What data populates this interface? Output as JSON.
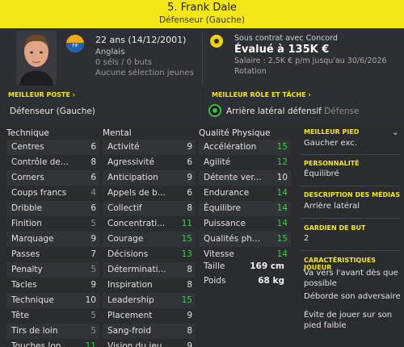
{
  "header": {
    "name": "5. Frank Dale",
    "role": "Défenseur (Gauche)"
  },
  "info": {
    "age": "22 ans (14/12/2001)",
    "nationality": "Anglais",
    "nation_badge": "FIP",
    "stats": "0 séls / 0 buts",
    "youth": "Aucune sélection jeunes",
    "contract": "Sous contrat avec Concord",
    "value": "Évalué à 135K €",
    "salary": "Salaire : 2,5K € p/m jusqu'au 30/6/2026",
    "rotation": "Rotation"
  },
  "best_position": {
    "title": "MEILLEUR POSTE",
    "value": "Défenseur (Gauche)"
  },
  "best_role": {
    "title": "MEILLEUR RÔLE ET TÂCHE",
    "value": "Arrière latéral défensif",
    "duty": "Défense"
  },
  "columns": {
    "technique": {
      "title": "Technique",
      "items": [
        {
          "label": "Centres",
          "value": "6"
        },
        {
          "label": "Contrôle de...",
          "value": "8"
        },
        {
          "label": "Corners",
          "value": "6"
        },
        {
          "label": "Coups francs",
          "value": "4"
        },
        {
          "label": "Dribble",
          "value": "6"
        },
        {
          "label": "Finition",
          "value": "5"
        },
        {
          "label": "Marquage",
          "value": "9"
        },
        {
          "label": "Passes",
          "value": "7"
        },
        {
          "label": "Penalty",
          "value": "5"
        },
        {
          "label": "Tacles",
          "value": "9"
        },
        {
          "label": "Technique",
          "value": "10"
        },
        {
          "label": "Tête",
          "value": "5"
        },
        {
          "label": "Tirs de loin",
          "value": "5"
        },
        {
          "label": "Touches lon...",
          "value": "11"
        }
      ]
    },
    "mental": {
      "title": "Mental",
      "items": [
        {
          "label": "Activité",
          "value": "9"
        },
        {
          "label": "Agressivité",
          "value": "6"
        },
        {
          "label": "Anticipation",
          "value": "9"
        },
        {
          "label": "Appels de b...",
          "value": "6"
        },
        {
          "label": "Collectif",
          "value": "8"
        },
        {
          "label": "Concentrati...",
          "value": "11"
        },
        {
          "label": "Courage",
          "value": "15"
        },
        {
          "label": "Décisions",
          "value": "13"
        },
        {
          "label": "Déterminati...",
          "value": "8"
        },
        {
          "label": "Inspiration",
          "value": "8"
        },
        {
          "label": "Leadership",
          "value": "15"
        },
        {
          "label": "Placement",
          "value": "9"
        },
        {
          "label": "Sang-froid",
          "value": "8"
        },
        {
          "label": "Vision du jeu",
          "value": "9"
        }
      ]
    },
    "physical": {
      "title": "Qualité Physique",
      "items": [
        {
          "label": "Accélération",
          "value": "15"
        },
        {
          "label": "Agilité",
          "value": "12"
        },
        {
          "label": "Détente ver...",
          "value": "10"
        },
        {
          "label": "Endurance",
          "value": "14"
        },
        {
          "label": "Équilibre",
          "value": "14"
        },
        {
          "label": "Puissance",
          "value": "14"
        },
        {
          "label": "Qualités ph...",
          "value": "15"
        },
        {
          "label": "Vitesse",
          "value": "14"
        }
      ],
      "height_label": "Taille",
      "height": "169 cm",
      "weight_label": "Poids",
      "weight": "68 kg"
    }
  },
  "sidebar": {
    "foot_title": "MEILLEUR PIED",
    "foot": "Gaucher exc.",
    "personality_title": "PERSONNALITÉ",
    "personality": "Équilibré",
    "media_title": "DESCRIPTION DES MÉDIAS",
    "media": "Arrière latéral",
    "gk_title": "GARDIEN DE BUT",
    "gk": "2",
    "traits_title": "CARACTÉRISTIQUES JOUEUR",
    "traits": [
      "Va vers l'avant dès que possible",
      "Déborde son adversaire",
      "Évite de jouer sur son pied faible"
    ]
  },
  "colors": {
    "accent": "#f5e61a",
    "high": "#2fd63f",
    "low": "#8f8f8f"
  }
}
